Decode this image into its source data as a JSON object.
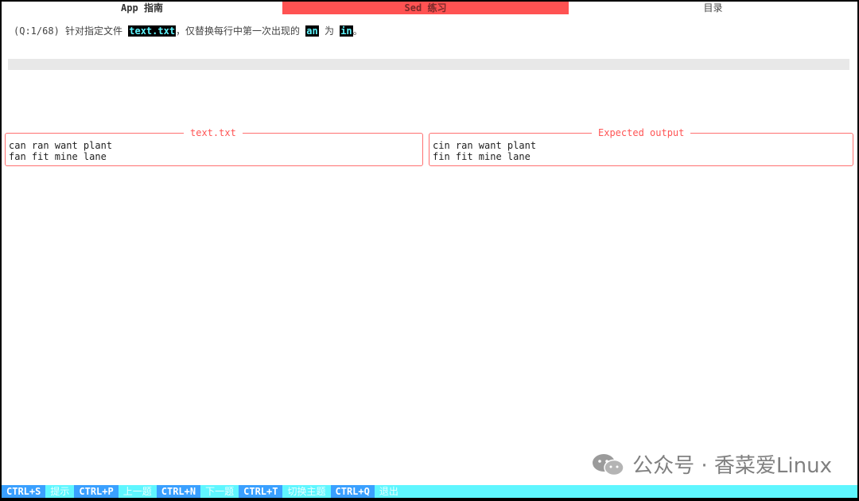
{
  "tabs": [
    {
      "label": "App 指南"
    },
    {
      "label": "Sed 练习"
    },
    {
      "label": "目录"
    }
  ],
  "question": {
    "prefix": "(Q:1/68) 针对指定文件 ",
    "file": "text.txt",
    "mid": "，仅替换每行中第一次出现的 ",
    "from": "an",
    "to_word": " 为 ",
    "to": "in",
    "suffix": "。"
  },
  "input_bar": {
    "value": ""
  },
  "panels": {
    "left": {
      "title": "text.txt",
      "lines": [
        "can ran want plant",
        "fan fit mine lane"
      ]
    },
    "right": {
      "title": "Expected output",
      "lines": [
        "cin ran want plant",
        "fin fit mine lane"
      ]
    }
  },
  "watermark": {
    "text": "公众号 · 香菜爱Linux"
  },
  "keybar": [
    {
      "key": "CTRL+S",
      "desc": "提示"
    },
    {
      "key": "CTRL+P",
      "desc": "上一题"
    },
    {
      "key": "CTRL+N",
      "desc": "下一题"
    },
    {
      "key": "CTRL+T",
      "desc": "切换主题"
    },
    {
      "key": "CTRL+Q",
      "desc": "退出"
    }
  ],
  "colors": {
    "active_tab": "#ff5252",
    "panel_border": "#ff7070",
    "highlight_bg": "#000000",
    "highlight_fg": "#5ff6ff",
    "keybar_bg": "#5ff6ff",
    "key_bg": "#3aa0ff"
  },
  "icons": {
    "watermark": "wechat-icon"
  }
}
